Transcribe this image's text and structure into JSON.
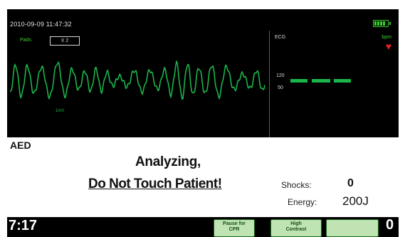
{
  "header": {
    "timestamp": "2010-09-09 11:47:32",
    "battery_icon": "battery-full-icon",
    "accent_color": "#3ad02e"
  },
  "waveform_panel": {
    "pads_label": "Pads",
    "lead_box": "X 2",
    "waveform_color": "#1bb54a",
    "inline_label": "1mV"
  },
  "ecg_panel": {
    "ecg_label": "ECG",
    "bpm_label": "bpm",
    "heart_icon": "heart-icon",
    "heart_color": "#e02020",
    "scale_max": "120",
    "scale_min": "50"
  },
  "message_panel": {
    "mode": "AED",
    "line1": "Analyzing,",
    "line2": "Do Not Touch Patient!",
    "shocks_label": "Shocks:",
    "shocks_value": "0",
    "energy_label": "Energy:",
    "energy_value": "200J"
  },
  "bottom_bar": {
    "elapsed_time": "7:17",
    "right_value": "0",
    "softkeys": [
      {
        "line1": "Pause for",
        "line2": "CPR"
      },
      {
        "line1": "High",
        "line2": "Contrast"
      },
      {
        "icon": "speaker-volume-icon"
      }
    ]
  }
}
